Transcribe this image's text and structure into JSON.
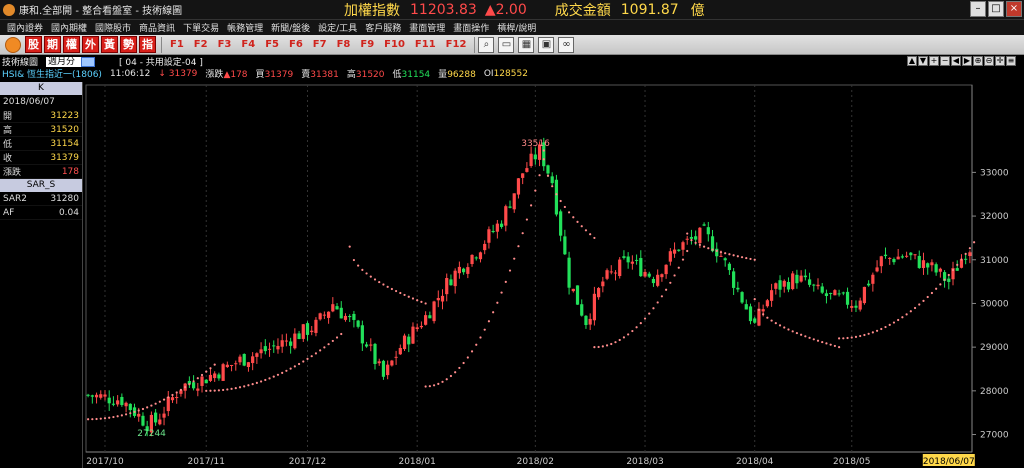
{
  "titlebar": {
    "app_title": "康和.全部開 - 整合看盤室 - 技術線圖",
    "index_label": "加權指數",
    "index_value": "11203.83",
    "index_change": "▲2.00",
    "turnover_label": "成交金額",
    "turnover_value": "1091.87",
    "turnover_unit": "億"
  },
  "menu": [
    "國內證券",
    "國內期權",
    "國際股市",
    "商品資訊",
    "下單交易",
    "帳務管理",
    "新聞/盤後",
    "設定/工具",
    "客戶服務",
    "畫面管理",
    "畫面操作",
    "槓桿/說明"
  ],
  "toolbar": {
    "red_buttons": [
      "股",
      "期",
      "權",
      "外",
      "黃",
      "勢",
      "指"
    ],
    "fkeys": [
      "F1",
      "F2",
      "F3",
      "F4",
      "F5",
      "F6",
      "F7",
      "F8",
      "F9",
      "F10",
      "F11",
      "F12"
    ],
    "icons": [
      "search-icon",
      "display-icon",
      "grid-icon",
      "window-icon",
      "link-icon"
    ]
  },
  "subheader": {
    "label": "技術線圖",
    "period": "週月分",
    "setting": "[ 04 - 共用設定-04 ]"
  },
  "quote": {
    "symbol": "HSI& 恆生指近一(1806)",
    "time": "11:06:12",
    "arrow_price": "↓ 31379",
    "chg_label": "漲跌",
    "chg_value": "▲178",
    "buy_label": "買",
    "buy_value": "31379",
    "sell_label": "賣",
    "sell_value": "31381",
    "high_label": "高",
    "high_value": "31520",
    "low_label": "低",
    "low_value": "31154",
    "vol_label": "量",
    "vol_value": "96288",
    "oi_label": "OI",
    "oi_value": "128552"
  },
  "panel": {
    "header_k": "K",
    "date": "2018/06/07",
    "open_label": "開",
    "open_value": "31223",
    "high_label": "高",
    "high_value": "31520",
    "low_label": "低",
    "low_value": "31154",
    "close_label": "收",
    "close_value": "31379",
    "chg_label": "漲跌",
    "chg_value": "178",
    "header_sar": "SAR_S",
    "sar_label": "SAR2",
    "sar_value": "31280",
    "af_label": "AF",
    "af_value": "0.04"
  },
  "colors": {
    "up": "#ff4a4a",
    "down": "#22e05a",
    "sar": "#ff8c8c",
    "axis": "#888888",
    "highlight": "#ffd84a"
  },
  "chart_data": {
    "type": "candlestick",
    "ylim": [
      26600,
      35000
    ],
    "y_ticks": [
      27000,
      28000,
      29000,
      30000,
      31000,
      32000,
      33000
    ],
    "x_labels": [
      "2017/10",
      "2017/11",
      "2017/12",
      "2018/01",
      "2018/02",
      "2018/03",
      "2018/04",
      "2018/05",
      "2018/06/07"
    ],
    "x_label_index": [
      4,
      28,
      52,
      78,
      106,
      132,
      158,
      181,
      204
    ],
    "annotations": [
      {
        "text": "33516",
        "index": 107,
        "value": 33516
      },
      {
        "text": "27244",
        "index": 16,
        "value": 27244
      }
    ],
    "n_bars": 210,
    "sar_segments": [
      {
        "from": 0,
        "to": 30,
        "start": 27350,
        "end": 28600
      },
      {
        "from": 28,
        "to": 60,
        "start": 28000,
        "end": 29300
      },
      {
        "from": 62,
        "to": 80,
        "start": 31300,
        "end": 30000
      },
      {
        "from": 80,
        "to": 108,
        "start": 28100,
        "end": 33300
      },
      {
        "from": 108,
        "to": 120,
        "start": 33500,
        "end": 31500
      },
      {
        "from": 120,
        "to": 142,
        "start": 29000,
        "end": 31200
      },
      {
        "from": 142,
        "to": 158,
        "start": 31600,
        "end": 31000
      },
      {
        "from": 158,
        "to": 178,
        "start": 30100,
        "end": 29000
      },
      {
        "from": 178,
        "to": 210,
        "start": 29200,
        "end": 31400
      }
    ],
    "close_path": [
      [
        0,
        27900
      ],
      [
        8,
        27800
      ],
      [
        14,
        27250
      ],
      [
        16,
        27300
      ],
      [
        22,
        28100
      ],
      [
        28,
        28300
      ],
      [
        36,
        28700
      ],
      [
        44,
        29000
      ],
      [
        50,
        29300
      ],
      [
        54,
        29500
      ],
      [
        58,
        30000
      ],
      [
        62,
        29600
      ],
      [
        66,
        29100
      ],
      [
        70,
        28300
      ],
      [
        74,
        29000
      ],
      [
        80,
        29700
      ],
      [
        86,
        30600
      ],
      [
        92,
        31200
      ],
      [
        98,
        31900
      ],
      [
        103,
        33000
      ],
      [
        107,
        33500
      ],
      [
        110,
        32800
      ],
      [
        114,
        30500
      ],
      [
        118,
        29600
      ],
      [
        122,
        30500
      ],
      [
        128,
        31000
      ],
      [
        134,
        30600
      ],
      [
        140,
        31300
      ],
      [
        146,
        31600
      ],
      [
        150,
        31100
      ],
      [
        154,
        30300
      ],
      [
        158,
        29500
      ],
      [
        162,
        30300
      ],
      [
        168,
        30600
      ],
      [
        174,
        30200
      ],
      [
        178,
        30100
      ],
      [
        182,
        30000
      ],
      [
        188,
        31000
      ],
      [
        194,
        31100
      ],
      [
        200,
        30800
      ],
      [
        204,
        30500
      ],
      [
        208,
        31200
      ],
      [
        210,
        31379
      ]
    ]
  }
}
